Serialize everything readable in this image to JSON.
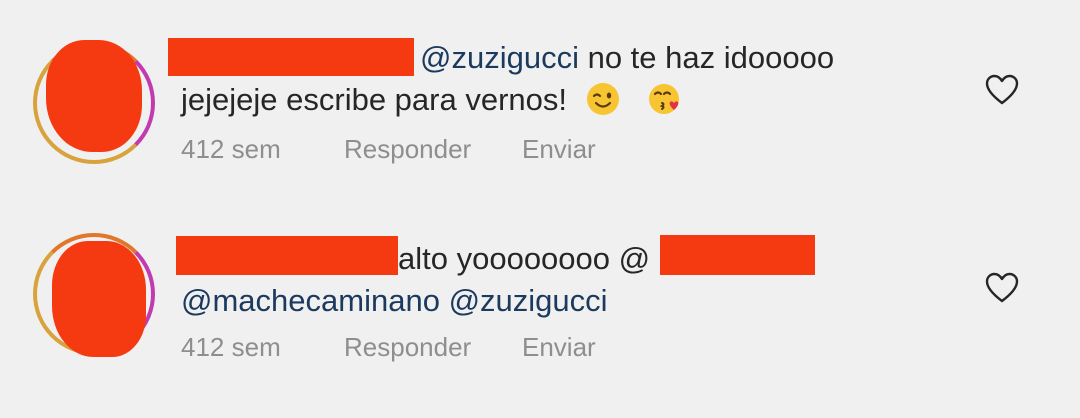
{
  "comments": [
    {
      "mention": "@zuzigucci",
      "line1_rest": " no te haz idooooo",
      "line2": "jejejeje escribe para vernos!",
      "emojis": [
        "winking-face-emoji",
        "kissing-heart-emoji"
      ],
      "time": "412 sem",
      "reply_label": "Responder",
      "send_label": "Enviar"
    },
    {
      "text_start": "alto yoooooooo @",
      "mention_1": "@machecaminano",
      "mention_2": "@zuzigucci",
      "time": "412 sem",
      "reply_label": "Responder",
      "send_label": "Enviar"
    }
  ],
  "colors": {
    "background": "#f0f0f0",
    "text": "#262626",
    "mention": "#1b3a5e",
    "meta": "#8e8e8e",
    "redaction": "#f53a12"
  }
}
